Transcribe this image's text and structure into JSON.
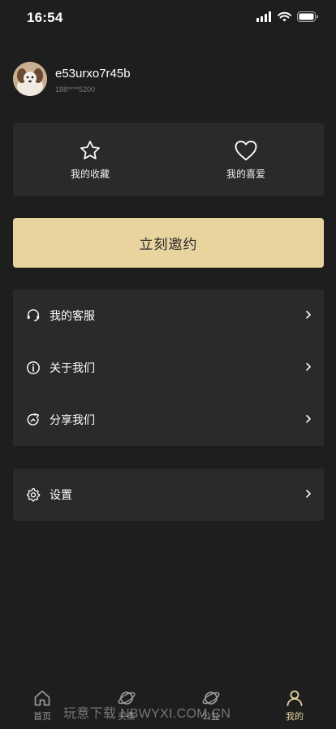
{
  "status_bar": {
    "time": "16:54"
  },
  "profile": {
    "username": "e53urxo7r45b",
    "phone": "188****5200"
  },
  "favorites": [
    {
      "label": "我的收藏",
      "icon": "star-icon"
    },
    {
      "label": "我的喜爱",
      "icon": "heart-icon"
    }
  ],
  "invite_button": {
    "label": "立刻邀约"
  },
  "menu_group_1": [
    {
      "label": "我的客服",
      "icon": "headset-icon"
    },
    {
      "label": "关于我们",
      "icon": "info-icon"
    },
    {
      "label": "分享我们",
      "icon": "share-icon"
    }
  ],
  "menu_group_2": [
    {
      "label": "设置",
      "icon": "gear-icon"
    }
  ],
  "tab_bar": {
    "tabs": [
      {
        "label": "首页",
        "icon": "home-icon"
      },
      {
        "label": "头条",
        "icon": "planet-icon"
      },
      {
        "label": "公益",
        "icon": "planet-icon"
      },
      {
        "label": "我的",
        "icon": "user-icon"
      }
    ],
    "active_index": 3
  },
  "watermark": "玩意下载 NBWYXI.COM.CN",
  "colors": {
    "background": "#1e1e1e",
    "card": "#2a2a2a",
    "accent": "#e9d49f"
  }
}
